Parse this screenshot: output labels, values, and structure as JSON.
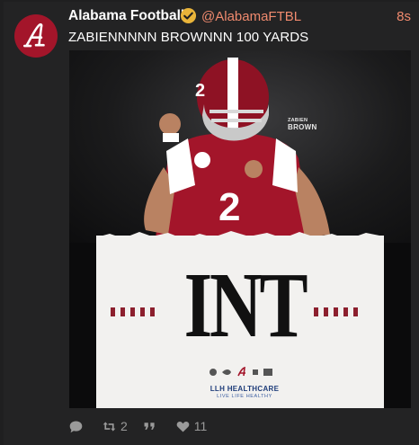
{
  "tweet": {
    "display_name": "Alabama Football",
    "handle": "@AlabamaFTBL",
    "time": "8s",
    "text": "ZABIENNNNN BROWNNN 100 YARDS"
  },
  "media": {
    "graphic_word": "INT",
    "jersey_number": "2",
    "helmet_number": "2",
    "player_tag_small": "ZABIEN",
    "player_tag_big": "BROWN",
    "sponsor": "LLH HEALTHCARE",
    "sponsor_tagline": "LIVE LIFE HEALTHY"
  },
  "actions": {
    "reply_count": "",
    "retweet_count": "2",
    "quote_count": "",
    "like_count": "11"
  },
  "colors": {
    "background": "#1f1f20",
    "accent_orange": "#f08a6e",
    "crimson": "#a3152a",
    "verified_gold": "#e9b43a"
  }
}
